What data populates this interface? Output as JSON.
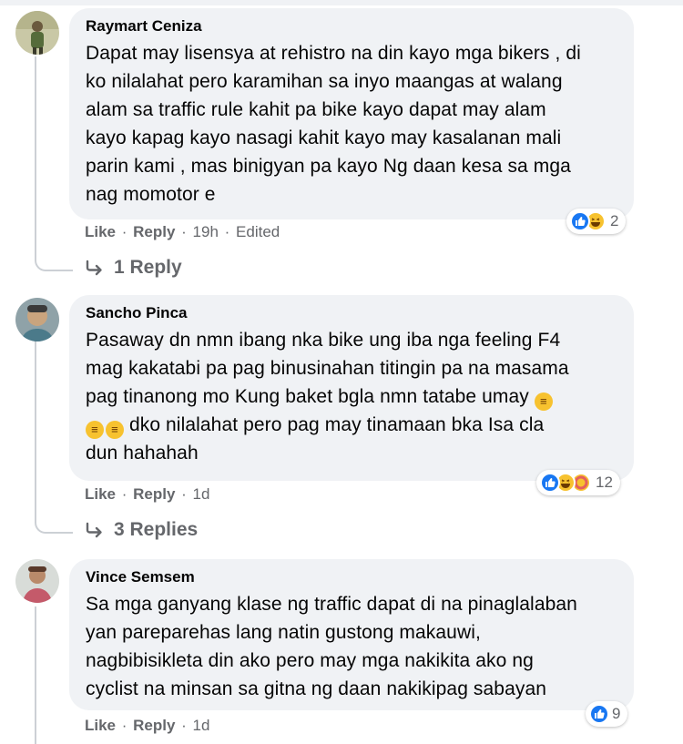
{
  "comments": [
    {
      "author": "Raymart Ceniza",
      "lines": [
        "Dapat may lisensya at rehistro na din kayo mga bikers , di",
        "ko nilalahat pero karamihan sa inyo maangas at walang",
        "alam sa traffic rule kahit pa bike kayo dapat may alam",
        "kayo kapag kayo nasagi kahit kayo may kasalanan mali",
        "parin kami , mas binigyan pa kayo Ng daan kesa sa mga",
        "nag momotor e"
      ],
      "like_label": "Like",
      "reply_label": "Reply",
      "time": "19h",
      "edited": "Edited",
      "reaction_count": "2",
      "reactions": [
        "like-icon",
        "haha-icon"
      ],
      "replies_label": "1 Reply"
    },
    {
      "author": "Sancho Pinca",
      "lines": [
        "Pasaway dn nmn ibang nka bike ung iba nga feeling F4",
        "mag kakatabi pa pag binusinahan titingin pa na masama",
        "pag tinanong mo Kung baket bgla nmn tatabe umay",
        "dko nilalahat pero pag may tinamaan bka Isa cla",
        "dun hahahah"
      ],
      "like_label": "Like",
      "reply_label": "Reply",
      "time": "1d",
      "reaction_count": "12",
      "reactions": [
        "like-icon",
        "haha-icon",
        "care-icon"
      ],
      "replies_label": "3 Replies"
    },
    {
      "author": "Vince Semsem",
      "lines": [
        "Sa mga ganyang klase ng traffic dapat di na pinaglalaban",
        "yan pareparehas lang natin gustong makauwi,",
        "nagbibisikleta din ako pero may mga nakikita ako ng",
        "cyclist na minsan sa gitna ng daan nakikipag sabayan"
      ],
      "like_label": "Like",
      "reply_label": "Reply",
      "time": "1d",
      "reaction_count": "9",
      "reactions": [
        "like-icon"
      ]
    }
  ],
  "colors": {
    "bubble": "#f0f2f5",
    "meta_text": "#65676b",
    "like_blue": "#1877f2",
    "haha_yellow": "#f7c22f"
  }
}
